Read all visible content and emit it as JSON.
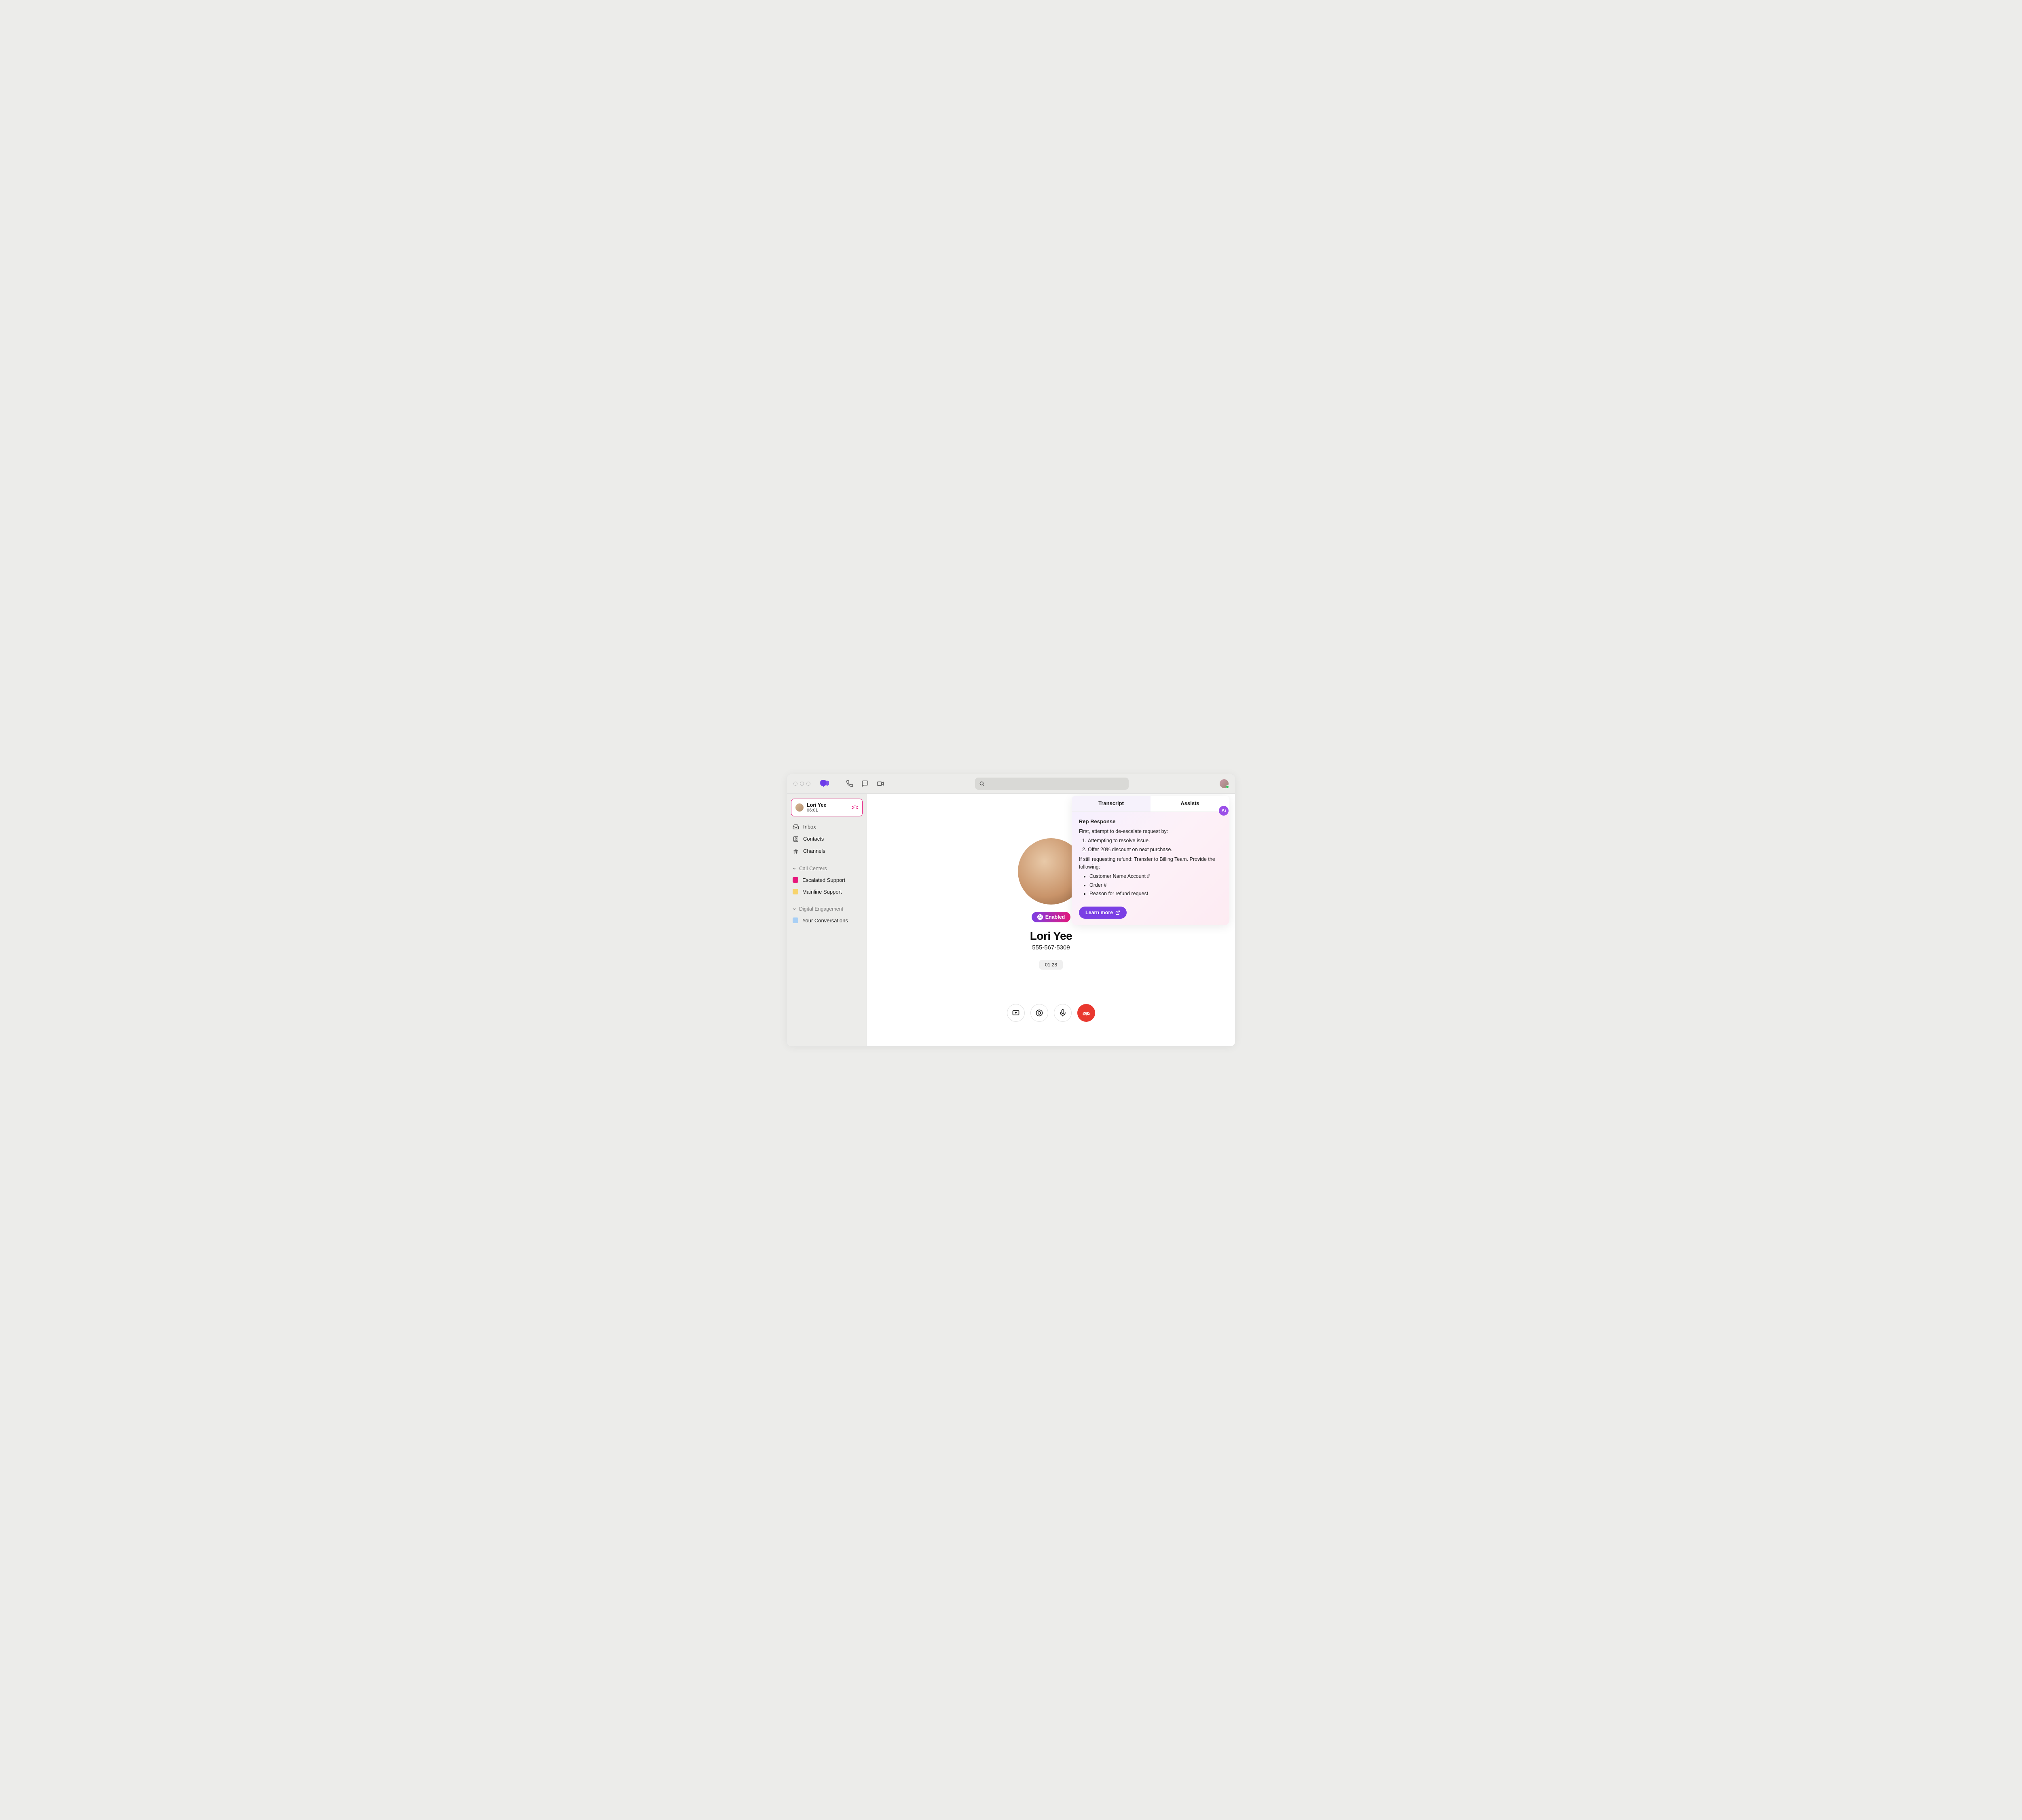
{
  "titlebar": {
    "search_placeholder": ""
  },
  "sidebar": {
    "active_call": {
      "name": "Lori Yee",
      "time": "06:01"
    },
    "nav": {
      "inbox": "Inbox",
      "contacts": "Contacts",
      "channels": "Channels"
    },
    "sections": {
      "call_centers": {
        "label": "Call Centers",
        "items": [
          {
            "label": "Escalated Support",
            "color": "pink"
          },
          {
            "label": "Mainline Support",
            "color": "yellow"
          }
        ]
      },
      "digital_engagement": {
        "label": "Digital Engagement",
        "items": [
          {
            "label": "Your Conversations",
            "color": "blue"
          }
        ]
      }
    }
  },
  "contact": {
    "enabled_label": "Enabled",
    "name": "Lori Yee",
    "phone": "555-567-5309",
    "timer": "01:28"
  },
  "assist": {
    "tabs": {
      "transcript": "Transcript",
      "assists": "Assists"
    },
    "heading": "Rep Response",
    "intro": "First, attempt to de-escalate request by:",
    "steps": [
      "Attempting to resolve issue.",
      "Offer 20% discount on next purchase."
    ],
    "followup": "If still requesting refund: Transfer to Billing Team. Provide the following:",
    "bullets": [
      "Customer Name Account #",
      "Order #",
      "Reason for refund request"
    ],
    "learn_more": "Learn more",
    "ai_label": "Ai"
  }
}
